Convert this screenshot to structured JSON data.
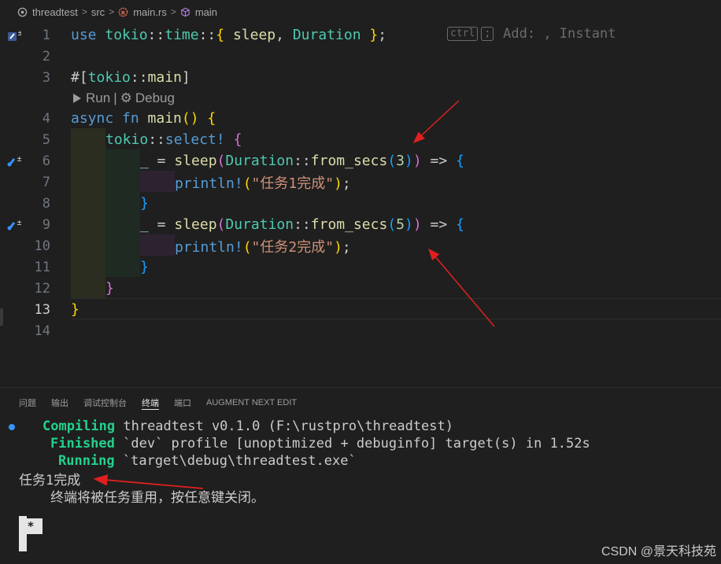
{
  "breadcrumb": {
    "items": [
      "threadtest",
      "src",
      "main.rs",
      "main"
    ],
    "separator": ">"
  },
  "editor": {
    "line_numbers": [
      "1",
      "2",
      "3",
      "4",
      "5",
      "6",
      "7",
      "8",
      "9",
      "10",
      "11",
      "12",
      "13",
      "14"
    ],
    "ghost_hint": {
      "key1": "ctrl",
      "key2": ";",
      "text": "Add: , Instant"
    },
    "codelens": {
      "run": "Run",
      "sep": "|",
      "debug": "Debug"
    },
    "l1": {
      "use": "use",
      "tokio": "tokio",
      "sep1": "::",
      "time": "time",
      "sep2": "::",
      "open": "{",
      "sleep": " sleep",
      "comma": ",",
      "duration": " Duration",
      "close": " }",
      "semi": ";"
    },
    "l3": {
      "hash": "#[",
      "tokio": "tokio",
      "sep": "::",
      "main": "main",
      "close": "]"
    },
    "l4": {
      "async": "async",
      "fn": " fn",
      "main": " main",
      "paren": "()",
      "brace": " {"
    },
    "l5": {
      "tokio": "tokio",
      "sep": "::",
      "select": "select!",
      "brace": " {"
    },
    "l6": {
      "under": "_",
      "eq": " = ",
      "sleep": "sleep",
      "p1": "(",
      "duration": "Duration",
      "sep": "::",
      "from": "from_secs",
      "p2": "(",
      "n": "3",
      "p3": ")",
      "p4": ")",
      "arrow": " => ",
      "brace": "{"
    },
    "l7": {
      "println": "println!",
      "p1": "(",
      "str": "\"任务1完成\"",
      "p2": ")",
      "semi": ";"
    },
    "l8": {
      "brace": "}"
    },
    "l9": {
      "under": "_",
      "eq": " = ",
      "sleep": "sleep",
      "p1": "(",
      "duration": "Duration",
      "sep": "::",
      "from": "from_secs",
      "p2": "(",
      "n": "5",
      "p3": ")",
      "p4": ")",
      "arrow": " => ",
      "brace": "{"
    },
    "l10": {
      "println": "println!",
      "p1": "(",
      "str": "\"任务2完成\"",
      "p2": ")",
      "semi": ";"
    },
    "l11": {
      "brace": "}"
    },
    "l12": {
      "brace": "}"
    },
    "l13": {
      "brace": "}"
    }
  },
  "panel": {
    "tabs": [
      "问题",
      "输出",
      "调试控制台",
      "终端",
      "端口",
      "AUGMENT NEXT EDIT"
    ],
    "active_tab": "终端",
    "terminal": {
      "l1_label": "Compiling",
      "l1_text": " threadtest v0.1.0 (F:\\rustpro\\threadtest)",
      "l2_label": "Finished",
      "l2_text": " `dev` profile [unoptimized + debuginfo] target(s) in 1.52s",
      "l3_label": "Running",
      "l3_text": " `target\\debug\\threadtest.exe`",
      "l4": "任务1完成",
      "star": "*",
      "l5": "终端将被任务重用，按任意键关闭。"
    }
  },
  "watermark": "CSDN @景天科技苑",
  "colors": {
    "background": "#1f1f1f",
    "keyword": "#569cd6",
    "type": "#4ec9b0",
    "function": "#dcdcaa",
    "string": "#ce9178",
    "number": "#b5cea8",
    "terminal_green": "#23d18b",
    "annotation_arrow": "#e02020"
  },
  "icons": [
    "target-icon",
    "rust-file-icon",
    "cube-icon",
    "edit-suggestion-icon",
    "play-icon",
    "gear-icon"
  ]
}
